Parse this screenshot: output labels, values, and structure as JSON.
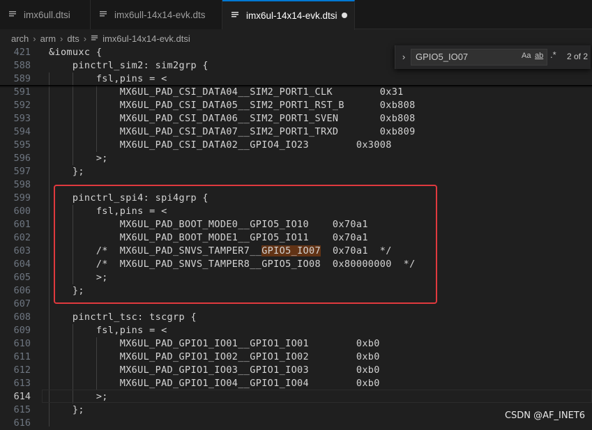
{
  "tabs": [
    {
      "label": "imx6ull.dtsi",
      "active": false,
      "modified": false
    },
    {
      "label": "imx6ull-14x14-evk.dts",
      "active": false,
      "modified": false
    },
    {
      "label": "imx6ul-14x14-evk.dtsi",
      "active": true,
      "modified": true
    }
  ],
  "breadcrumb": [
    "arch",
    "arm",
    "dts",
    "imx6ul-14x14-evk.dtsi"
  ],
  "find": {
    "query": "GPIO5_IO07",
    "match_case_label": "Aa",
    "whole_word_label": "ab",
    "regex_label": ".*",
    "result": "2 of 2"
  },
  "code_lines": [
    {
      "n": "421",
      "text": "&iomuxc {"
    },
    {
      "n": "588",
      "text": "    pinctrl_sim2: sim2grp {"
    },
    {
      "n": "589",
      "text": "        fsl,pins = <"
    },
    {
      "n": "591",
      "text": "            MX6UL_PAD_CSI_DATA04__SIM2_PORT1_CLK        0x31"
    },
    {
      "n": "592",
      "text": "            MX6UL_PAD_CSI_DATA05__SIM2_PORT1_RST_B      0xb808"
    },
    {
      "n": "593",
      "text": "            MX6UL_PAD_CSI_DATA06__SIM2_PORT1_SVEN       0xb808"
    },
    {
      "n": "594",
      "text": "            MX6UL_PAD_CSI_DATA07__SIM2_PORT1_TRXD       0xb809"
    },
    {
      "n": "595",
      "text": "            MX6UL_PAD_CSI_DATA02__GPIO4_IO23        0x3008"
    },
    {
      "n": "596",
      "text": "        >;"
    },
    {
      "n": "597",
      "text": "    };"
    },
    {
      "n": "598",
      "text": ""
    },
    {
      "n": "599",
      "text": "    pinctrl_spi4: spi4grp {"
    },
    {
      "n": "600",
      "text": "        fsl,pins = <"
    },
    {
      "n": "601",
      "text": "            MX6UL_PAD_BOOT_MODE0__GPIO5_IO10    0x70a1"
    },
    {
      "n": "602",
      "text": "            MX6UL_PAD_BOOT_MODE1__GPIO5_IO11    0x70a1"
    },
    {
      "n": "603",
      "text": "        /*  MX6UL_PAD_SNVS_TAMPER7__",
      "hl": "GPIO5_IO07",
      "tail": "  0x70a1  */"
    },
    {
      "n": "604",
      "text": "        /*  MX6UL_PAD_SNVS_TAMPER8__GPIO5_IO08  0x80000000  */"
    },
    {
      "n": "605",
      "text": "        >;"
    },
    {
      "n": "606",
      "text": "    };"
    },
    {
      "n": "607",
      "text": ""
    },
    {
      "n": "608",
      "text": "    pinctrl_tsc: tscgrp {"
    },
    {
      "n": "609",
      "text": "        fsl,pins = <"
    },
    {
      "n": "610",
      "text": "            MX6UL_PAD_GPIO1_IO01__GPIO1_IO01        0xb0"
    },
    {
      "n": "611",
      "text": "            MX6UL_PAD_GPIO1_IO02__GPIO1_IO02        0xb0"
    },
    {
      "n": "612",
      "text": "            MX6UL_PAD_GPIO1_IO03__GPIO1_IO03        0xb0"
    },
    {
      "n": "613",
      "text": "            MX6UL_PAD_GPIO1_IO04__GPIO1_IO04        0xb0"
    },
    {
      "n": "614",
      "text": "        >;",
      "current": true
    },
    {
      "n": "615",
      "text": "    };"
    },
    {
      "n": "616",
      "text": ""
    }
  ],
  "watermark": "CSDN @AF_INET6",
  "colors": {
    "accent": "#0078d4",
    "annotation_box": "#e0393e",
    "find_highlight": "#623315"
  }
}
